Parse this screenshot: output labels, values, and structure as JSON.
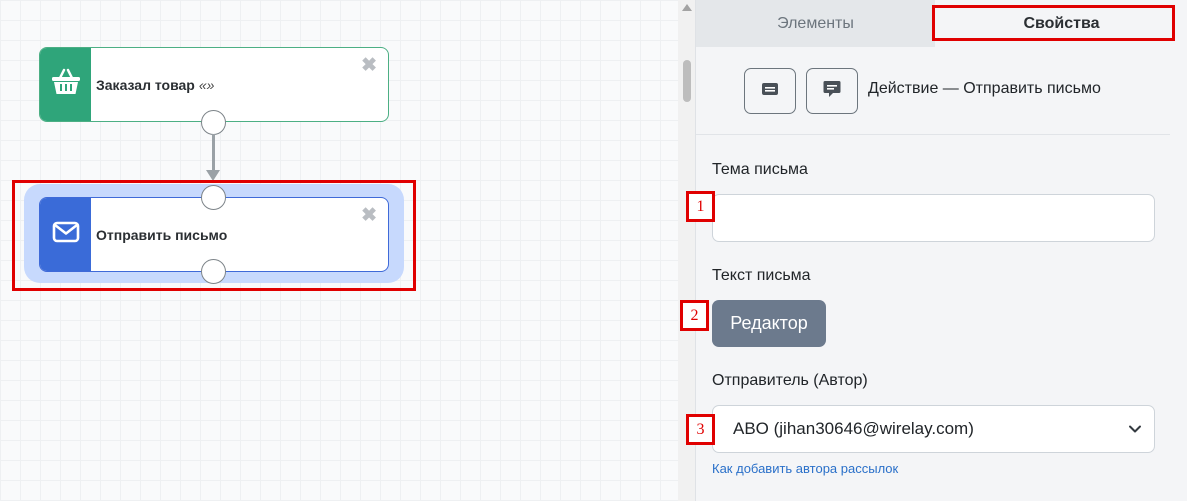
{
  "canvas": {
    "nodes": [
      {
        "title": "Заказал товар",
        "quote": "«»",
        "icon": "basket-icon",
        "color": "#2fa57a"
      },
      {
        "title": "Отправить письмо",
        "icon": "envelope-icon",
        "color": "#3a6bd8"
      }
    ],
    "close_glyph": "✖"
  },
  "panel": {
    "tabs": {
      "elements": "Элементы",
      "properties": "Свойства"
    },
    "action_title": "Действие — Отправить письмо",
    "subject_label": "Тема письма",
    "subject_value": "",
    "body_label": "Текст письма",
    "editor_button": "Редактор",
    "sender_label": "Отправитель (Автор)",
    "sender_value": "ABO (jihan30646@wirelay.com)",
    "help_link": "Как добавить автора рассылок"
  },
  "annotations": {
    "marker1": "1",
    "marker2": "2",
    "marker3": "3",
    "color": "#e00000"
  }
}
